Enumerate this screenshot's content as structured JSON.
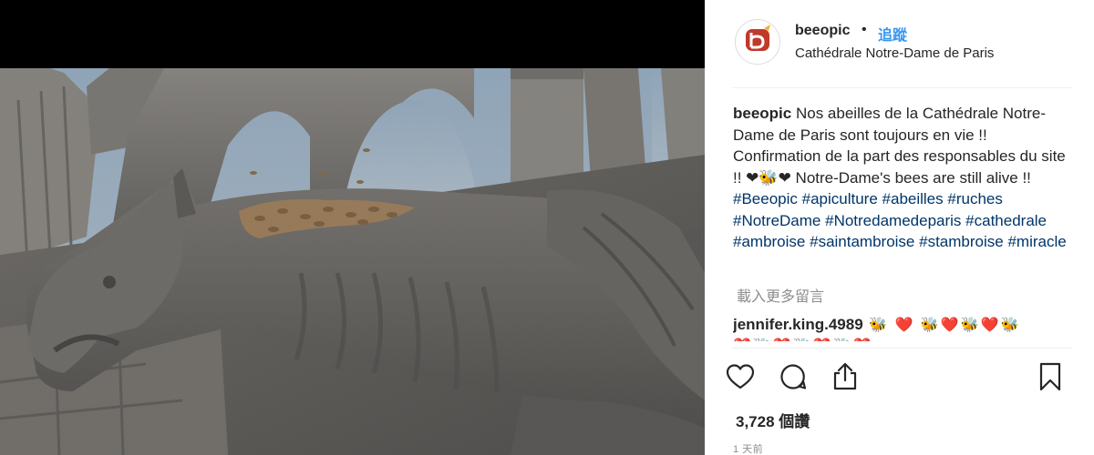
{
  "post": {
    "username": "beeopic",
    "separator": "•",
    "follow_label": "追蹤",
    "location": "Cathédrale Notre-Dame de Paris",
    "avatar_text": "beeopic"
  },
  "caption": {
    "username": "beeopic",
    "text_1": " Nos abeilles de la Cathédrale Notre-Dame de Paris sont toujours en vie !! Confirmation de la part des responsables du site !! ❤🐝❤ Notre-Dame's bees are still alive !! ",
    "hashtags": [
      "#Beeopic",
      "#apiculture",
      "#abeilles",
      "#ruches",
      "#NotreDame",
      "#Notredamedeparis",
      "#cathedrale",
      "#ambroise",
      "#saintambroise",
      "#stambroise",
      "#miracle"
    ]
  },
  "load_more_label": "載入更多留言",
  "comments": [
    {
      "username": "jennifer.king.4989",
      "text": " 🐝 ❤️  🐝❤️🐝❤️🐝",
      "text_row2": "❤️🐝❤️🐝❤️🐝❤️"
    }
  ],
  "actions": {
    "like": "heart-icon",
    "comment": "speech-bubble-icon",
    "share": "share-icon",
    "save": "bookmark-icon"
  },
  "views_label": "3,728 個讚",
  "timestamp": "1 天前",
  "colors": {
    "link": "#003569",
    "follow": "#3897f0",
    "muted": "#8e8e8e",
    "avatar_brand": "#c0392b"
  }
}
